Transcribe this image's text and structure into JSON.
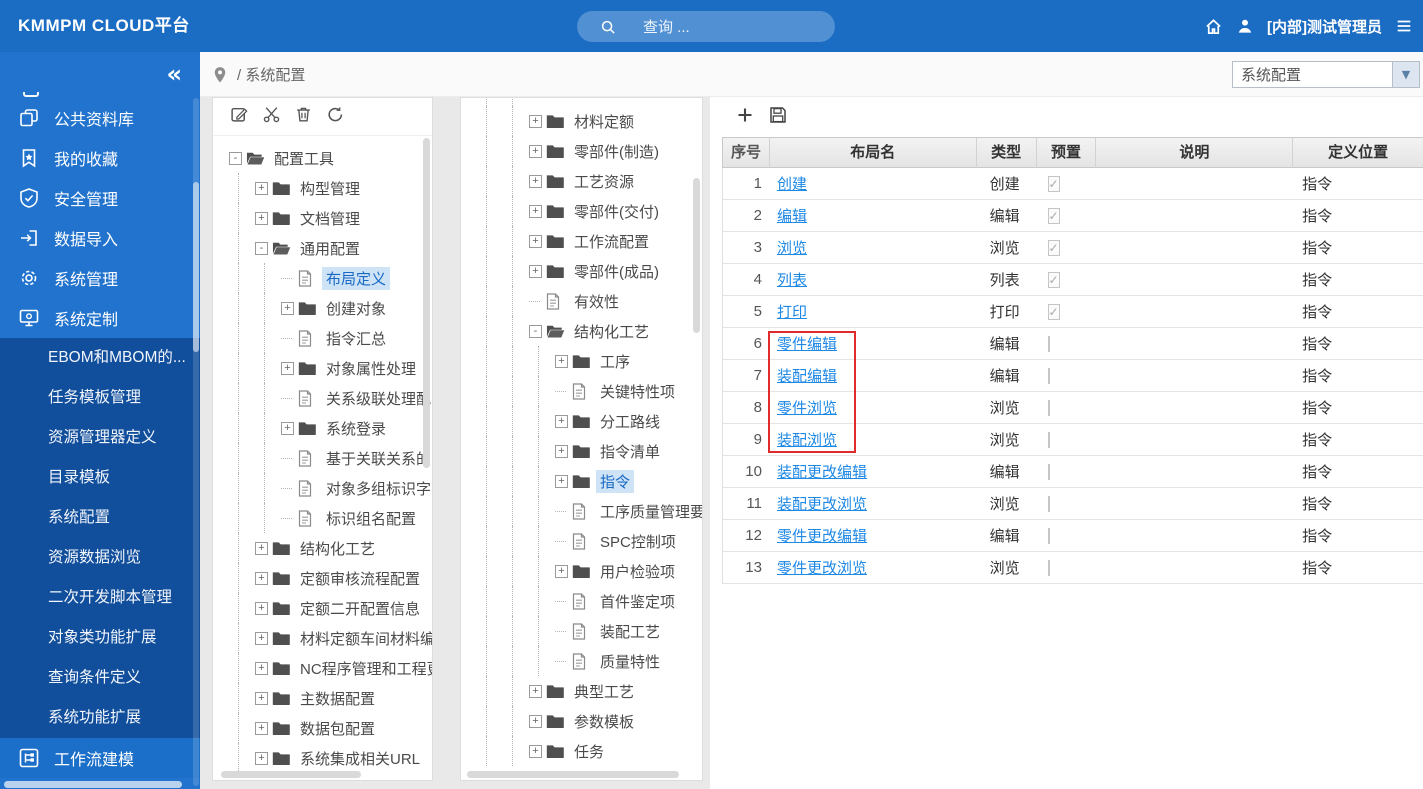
{
  "colors": {
    "header_blue": "#1b6dc4",
    "sidebar_blue": "#2173cd",
    "submenu_navy": "#114e9b",
    "link_blue": "#1e88e5",
    "annotation_red": "#e02b2b",
    "tree_selected_bg": "#cfe3f7",
    "tree_selected_text": "#1769c4"
  },
  "header": {
    "title": "KMMPM CLOUD平台",
    "search_placeholder": "查询 ...",
    "user_name": "[内部]测试管理员",
    "icons": [
      "search-icon",
      "home-icon",
      "user-icon",
      "menu-icon"
    ]
  },
  "breadcrumb": {
    "text": "/ 系统配置",
    "icon": "location-pin-icon"
  },
  "context_select": {
    "value": "系统配置",
    "arrow": "▼"
  },
  "sidebar": {
    "collapse_glyph": "«",
    "items": [
      {
        "label": "公共资料库",
        "icon": "copy-icon"
      },
      {
        "label": "我的收藏",
        "icon": "bookmark-icon"
      },
      {
        "label": "安全管理",
        "icon": "shield-icon"
      },
      {
        "label": "数据导入",
        "icon": "import-icon"
      },
      {
        "label": "系统管理",
        "icon": "gear-icon"
      },
      {
        "label": "系统定制",
        "icon": "monitor-icon"
      }
    ],
    "sub_items": [
      "EBOM和MBOM的...",
      "任务模板管理",
      "资源管理器定义",
      "目录模板",
      "系统配置",
      "资源数据浏览",
      "二次开发脚本管理",
      "对象类功能扩展",
      "查询条件定义",
      "系统功能扩展"
    ],
    "bottom_item": {
      "label": "工作流建模",
      "icon": "workflow-icon"
    }
  },
  "tree_toolbar": [
    "edit-icon",
    "cut-icon",
    "delete-icon",
    "refresh-icon"
  ],
  "tree1": {
    "nodes": [
      {
        "lvl": 0,
        "exp": "minus",
        "icon": "folder-open-icon",
        "label": "配置工具"
      },
      {
        "lvl": 1,
        "exp": "plus",
        "icon": "folder-icon",
        "label": "构型管理"
      },
      {
        "lvl": 1,
        "exp": "plus",
        "icon": "folder-icon",
        "label": "文档管理"
      },
      {
        "lvl": 1,
        "exp": "minus",
        "icon": "folder-open-icon",
        "label": "通用配置"
      },
      {
        "lvl": 2,
        "exp": "none",
        "icon": "doc-icon",
        "label": "布局定义",
        "selected": true
      },
      {
        "lvl": 2,
        "exp": "plus",
        "icon": "folder-icon",
        "label": "创建对象"
      },
      {
        "lvl": 2,
        "exp": "none",
        "icon": "doc-icon",
        "label": "指令汇总"
      },
      {
        "lvl": 2,
        "exp": "plus",
        "icon": "folder-icon",
        "label": "对象属性处理"
      },
      {
        "lvl": 2,
        "exp": "none",
        "icon": "doc-icon",
        "label": "关系级联处理配"
      },
      {
        "lvl": 2,
        "exp": "plus",
        "icon": "folder-icon",
        "label": "系统登录"
      },
      {
        "lvl": 2,
        "exp": "none",
        "icon": "doc-icon",
        "label": "基于关联关系的"
      },
      {
        "lvl": 2,
        "exp": "none",
        "icon": "doc-icon",
        "label": "对象多组标识字"
      },
      {
        "lvl": 2,
        "exp": "none",
        "icon": "doc-icon",
        "label": "标识组名配置"
      },
      {
        "lvl": 1,
        "exp": "plus",
        "icon": "folder-icon",
        "label": "结构化工艺"
      },
      {
        "lvl": 1,
        "exp": "plus",
        "icon": "folder-icon",
        "label": "定额审核流程配置"
      },
      {
        "lvl": 1,
        "exp": "plus",
        "icon": "folder-icon",
        "label": "定额二开配置信息"
      },
      {
        "lvl": 1,
        "exp": "plus",
        "icon": "folder-icon",
        "label": "材料定额车间材料编"
      },
      {
        "lvl": 1,
        "exp": "plus",
        "icon": "folder-icon",
        "label": "NC程序管理和工程更"
      },
      {
        "lvl": 1,
        "exp": "plus",
        "icon": "folder-icon",
        "label": "主数据配置"
      },
      {
        "lvl": 1,
        "exp": "plus",
        "icon": "folder-icon",
        "label": "数据包配置"
      },
      {
        "lvl": 1,
        "exp": "plus",
        "icon": "folder-icon",
        "label": "系统集成相关URL"
      }
    ]
  },
  "tree2": {
    "nodes": [
      {
        "lvl": 2,
        "exp": "plus",
        "icon": "folder-icon",
        "label": "",
        "partial": true
      },
      {
        "lvl": 2,
        "exp": "plus",
        "icon": "folder-icon",
        "label": "材料定额"
      },
      {
        "lvl": 2,
        "exp": "plus",
        "icon": "folder-icon",
        "label": "零部件(制造)"
      },
      {
        "lvl": 2,
        "exp": "plus",
        "icon": "folder-icon",
        "label": "工艺资源"
      },
      {
        "lvl": 2,
        "exp": "plus",
        "icon": "folder-icon",
        "label": "零部件(交付)"
      },
      {
        "lvl": 2,
        "exp": "plus",
        "icon": "folder-icon",
        "label": "工作流配置"
      },
      {
        "lvl": 2,
        "exp": "plus",
        "icon": "folder-icon",
        "label": "零部件(成品)"
      },
      {
        "lvl": 2,
        "exp": "none",
        "icon": "doc-icon",
        "label": "有效性"
      },
      {
        "lvl": 2,
        "exp": "minus",
        "icon": "folder-open-icon",
        "label": "结构化工艺"
      },
      {
        "lvl": 3,
        "exp": "plus",
        "icon": "folder-icon",
        "label": "工序"
      },
      {
        "lvl": 3,
        "exp": "none",
        "icon": "doc-icon",
        "label": "关键特性项"
      },
      {
        "lvl": 3,
        "exp": "plus",
        "icon": "folder-icon",
        "label": "分工路线"
      },
      {
        "lvl": 3,
        "exp": "plus",
        "icon": "folder-icon",
        "label": "指令清单"
      },
      {
        "lvl": 3,
        "exp": "plus",
        "icon": "folder-icon",
        "label": "指令",
        "selected": true
      },
      {
        "lvl": 3,
        "exp": "none",
        "icon": "doc-icon",
        "label": "工序质量管理要求"
      },
      {
        "lvl": 3,
        "exp": "none",
        "icon": "doc-icon",
        "label": "SPC控制项"
      },
      {
        "lvl": 3,
        "exp": "plus",
        "icon": "folder-icon",
        "label": "用户检验项"
      },
      {
        "lvl": 3,
        "exp": "none",
        "icon": "doc-icon",
        "label": "首件鉴定项"
      },
      {
        "lvl": 3,
        "exp": "none",
        "icon": "doc-icon",
        "label": "装配工艺"
      },
      {
        "lvl": 3,
        "exp": "none",
        "icon": "doc-icon",
        "label": "质量特性"
      },
      {
        "lvl": 2,
        "exp": "plus",
        "icon": "folder-icon",
        "label": "典型工艺"
      },
      {
        "lvl": 2,
        "exp": "plus",
        "icon": "folder-icon",
        "label": "参数模板"
      },
      {
        "lvl": 2,
        "exp": "plus",
        "icon": "folder-icon",
        "label": "任务"
      }
    ]
  },
  "table_toolbar": [
    "add-icon",
    "save-icon"
  ],
  "table": {
    "columns": [
      "序号",
      "布局名",
      "类型",
      "预置",
      "说明",
      "定义位置"
    ],
    "check_glyph": "✓",
    "rows": [
      {
        "seq": "1",
        "name": "创建",
        "type": "创建",
        "preset": true,
        "desc": "",
        "loc": "指令"
      },
      {
        "seq": "2",
        "name": "编辑",
        "type": "编辑",
        "preset": true,
        "desc": "",
        "loc": "指令"
      },
      {
        "seq": "3",
        "name": "浏览",
        "type": "浏览",
        "preset": true,
        "desc": "",
        "loc": "指令"
      },
      {
        "seq": "4",
        "name": "列表",
        "type": "列表",
        "preset": true,
        "desc": "",
        "loc": "指令"
      },
      {
        "seq": "5",
        "name": "打印",
        "type": "打印",
        "preset": true,
        "desc": "",
        "loc": "指令"
      },
      {
        "seq": "6",
        "name": "零件编辑",
        "type": "编辑",
        "preset": false,
        "desc": "",
        "loc": "指令"
      },
      {
        "seq": "7",
        "name": "装配编辑",
        "type": "编辑",
        "preset": false,
        "desc": "",
        "loc": "指令"
      },
      {
        "seq": "8",
        "name": "零件浏览",
        "type": "浏览",
        "preset": false,
        "desc": "",
        "loc": "指令"
      },
      {
        "seq": "9",
        "name": "装配浏览",
        "type": "浏览",
        "preset": false,
        "desc": "",
        "loc": "指令"
      },
      {
        "seq": "10",
        "name": "装配更改编辑",
        "type": "编辑",
        "preset": false,
        "desc": "",
        "loc": "指令"
      },
      {
        "seq": "11",
        "name": "装配更改浏览",
        "type": "浏览",
        "preset": false,
        "desc": "",
        "loc": "指令"
      },
      {
        "seq": "12",
        "name": "零件更改编辑",
        "type": "编辑",
        "preset": false,
        "desc": "",
        "loc": "指令"
      },
      {
        "seq": "13",
        "name": "零件更改浏览",
        "type": "浏览",
        "preset": false,
        "desc": "",
        "loc": "指令"
      }
    ],
    "annotation": {
      "first_row": 6,
      "last_row": 9,
      "column": "布局名"
    }
  }
}
